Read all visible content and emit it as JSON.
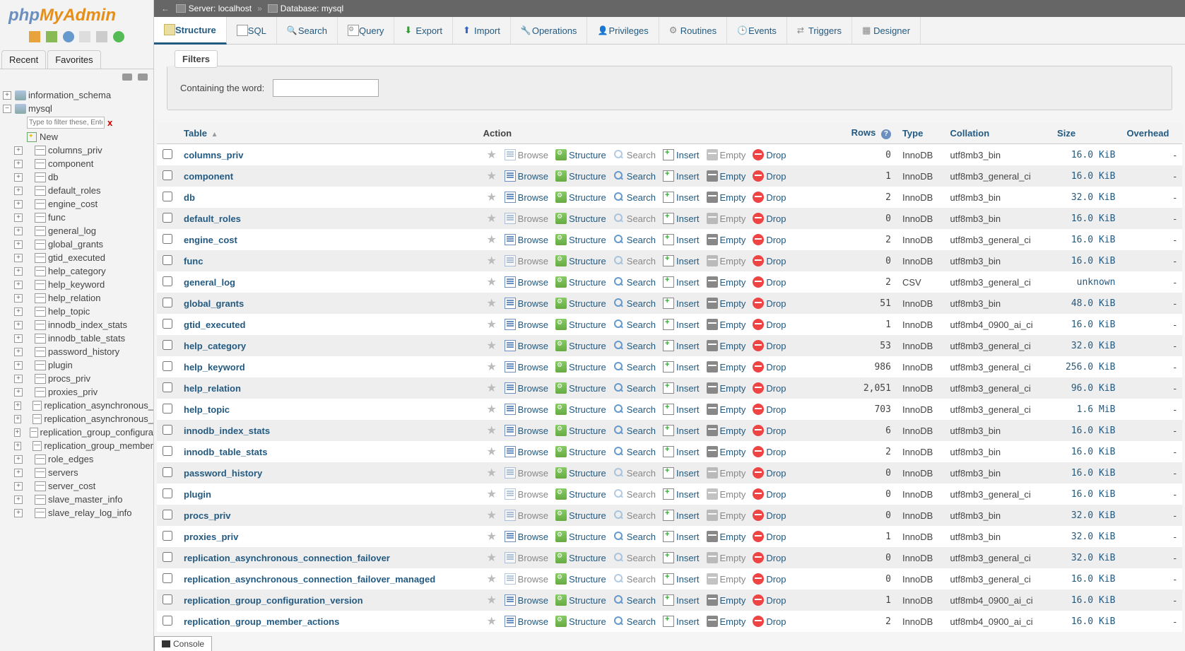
{
  "logo": {
    "p1": "php",
    "p2": "MyAdmin"
  },
  "sidebar_tabs": {
    "recent": "Recent",
    "favorites": "Favorites"
  },
  "tree": {
    "db1": "information_schema",
    "db2": "mysql",
    "filter_placeholder": "Type to filter these, Enter t",
    "new_label": "New",
    "tables": [
      "columns_priv",
      "component",
      "db",
      "default_roles",
      "engine_cost",
      "func",
      "general_log",
      "global_grants",
      "gtid_executed",
      "help_category",
      "help_keyword",
      "help_relation",
      "help_topic",
      "innodb_index_stats",
      "innodb_table_stats",
      "password_history",
      "plugin",
      "procs_priv",
      "proxies_priv",
      "replication_asynchronous_",
      "replication_asynchronous_",
      "replication_group_configura",
      "replication_group_member",
      "role_edges",
      "servers",
      "server_cost",
      "slave_master_info",
      "slave_relay_log_info"
    ]
  },
  "breadcrumb": {
    "server_label": "Server:",
    "server": "localhost",
    "db_label": "Database:",
    "db": "mysql"
  },
  "topnav": [
    {
      "label": "Structure",
      "active": true,
      "icon": "ni-struct"
    },
    {
      "label": "SQL",
      "icon": "ni-sql"
    },
    {
      "label": "Search",
      "icon": "ni-search"
    },
    {
      "label": "Query",
      "icon": "ni-query"
    },
    {
      "label": "Export",
      "icon": "ni-export"
    },
    {
      "label": "Import",
      "icon": "ni-import"
    },
    {
      "label": "Operations",
      "icon": "ni-ops"
    },
    {
      "label": "Privileges",
      "icon": "ni-priv"
    },
    {
      "label": "Routines",
      "icon": "ni-rout"
    },
    {
      "label": "Events",
      "icon": "ni-events"
    },
    {
      "label": "Triggers",
      "icon": "ni-trig"
    },
    {
      "label": "Designer",
      "icon": "ni-design"
    }
  ],
  "filters": {
    "legend": "Filters",
    "label": "Containing the word:"
  },
  "headers": {
    "table": "Table",
    "action": "Action",
    "rows": "Rows",
    "type": "Type",
    "collation": "Collation",
    "size": "Size",
    "overhead": "Overhead"
  },
  "actions": {
    "browse": "Browse",
    "structure": "Structure",
    "search": "Search",
    "insert": "Insert",
    "empty": "Empty",
    "drop": "Drop"
  },
  "rows": [
    {
      "name": "columns_priv",
      "rows": "0",
      "type": "InnoDB",
      "coll": "utf8mb3_bin",
      "size": "16.0 KiB",
      "ov": "-",
      "dis": true
    },
    {
      "name": "component",
      "rows": "1",
      "type": "InnoDB",
      "coll": "utf8mb3_general_ci",
      "size": "16.0 KiB",
      "ov": "-"
    },
    {
      "name": "db",
      "rows": "2",
      "type": "InnoDB",
      "coll": "utf8mb3_bin",
      "size": "32.0 KiB",
      "ov": "-"
    },
    {
      "name": "default_roles",
      "rows": "0",
      "type": "InnoDB",
      "coll": "utf8mb3_bin",
      "size": "16.0 KiB",
      "ov": "-",
      "dis": true
    },
    {
      "name": "engine_cost",
      "rows": "2",
      "type": "InnoDB",
      "coll": "utf8mb3_general_ci",
      "size": "16.0 KiB",
      "ov": "-"
    },
    {
      "name": "func",
      "rows": "0",
      "type": "InnoDB",
      "coll": "utf8mb3_bin",
      "size": "16.0 KiB",
      "ov": "-",
      "dis": true
    },
    {
      "name": "general_log",
      "rows": "2",
      "type": "CSV",
      "coll": "utf8mb3_general_ci",
      "size": "unknown",
      "ov": "-"
    },
    {
      "name": "global_grants",
      "rows": "51",
      "type": "InnoDB",
      "coll": "utf8mb3_bin",
      "size": "48.0 KiB",
      "ov": "-"
    },
    {
      "name": "gtid_executed",
      "rows": "1",
      "type": "InnoDB",
      "coll": "utf8mb4_0900_ai_ci",
      "size": "16.0 KiB",
      "ov": "-"
    },
    {
      "name": "help_category",
      "rows": "53",
      "type": "InnoDB",
      "coll": "utf8mb3_general_ci",
      "size": "32.0 KiB",
      "ov": "-"
    },
    {
      "name": "help_keyword",
      "rows": "986",
      "type": "InnoDB",
      "coll": "utf8mb3_general_ci",
      "size": "256.0 KiB",
      "ov": "-"
    },
    {
      "name": "help_relation",
      "rows": "2,051",
      "type": "InnoDB",
      "coll": "utf8mb3_general_ci",
      "size": "96.0 KiB",
      "ov": "-"
    },
    {
      "name": "help_topic",
      "rows": "703",
      "type": "InnoDB",
      "coll": "utf8mb3_general_ci",
      "size": "1.6 MiB",
      "ov": "-"
    },
    {
      "name": "innodb_index_stats",
      "rows": "6",
      "type": "InnoDB",
      "coll": "utf8mb3_bin",
      "size": "16.0 KiB",
      "ov": "-"
    },
    {
      "name": "innodb_table_stats",
      "rows": "2",
      "type": "InnoDB",
      "coll": "utf8mb3_bin",
      "size": "16.0 KiB",
      "ov": "-"
    },
    {
      "name": "password_history",
      "rows": "0",
      "type": "InnoDB",
      "coll": "utf8mb3_bin",
      "size": "16.0 KiB",
      "ov": "-",
      "dis": true
    },
    {
      "name": "plugin",
      "rows": "0",
      "type": "InnoDB",
      "coll": "utf8mb3_general_ci",
      "size": "16.0 KiB",
      "ov": "-",
      "dis": true
    },
    {
      "name": "procs_priv",
      "rows": "0",
      "type": "InnoDB",
      "coll": "utf8mb3_bin",
      "size": "32.0 KiB",
      "ov": "-",
      "dis": true
    },
    {
      "name": "proxies_priv",
      "rows": "1",
      "type": "InnoDB",
      "coll": "utf8mb3_bin",
      "size": "32.0 KiB",
      "ov": "-"
    },
    {
      "name": "replication_asynchronous_connection_failover",
      "rows": "0",
      "type": "InnoDB",
      "coll": "utf8mb3_general_ci",
      "size": "32.0 KiB",
      "ov": "-",
      "dis": true
    },
    {
      "name": "replication_asynchronous_connection_failover_managed",
      "rows": "0",
      "type": "InnoDB",
      "coll": "utf8mb3_general_ci",
      "size": "16.0 KiB",
      "ov": "-",
      "dis": true
    },
    {
      "name": "replication_group_configuration_version",
      "rows": "1",
      "type": "InnoDB",
      "coll": "utf8mb4_0900_ai_ci",
      "size": "16.0 KiB",
      "ov": "-"
    },
    {
      "name": "replication_group_member_actions",
      "rows": "2",
      "type": "InnoDB",
      "coll": "utf8mb4_0900_ai_ci",
      "size": "16.0 KiB",
      "ov": "-"
    }
  ],
  "console": "Console"
}
